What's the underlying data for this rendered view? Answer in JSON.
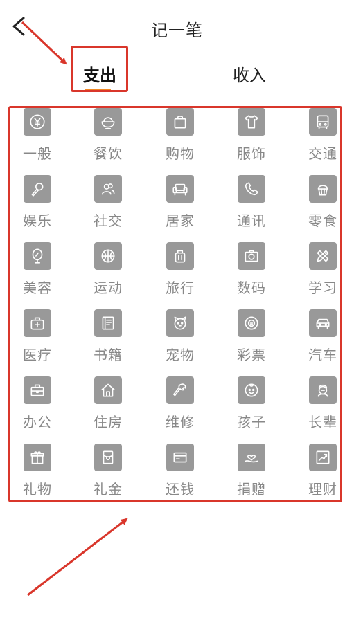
{
  "header": {
    "title": "记一笔",
    "back_icon": "chevron-left-icon"
  },
  "tabs": [
    {
      "label": "支出",
      "selected": true
    },
    {
      "label": "收入",
      "selected": false
    }
  ],
  "colors": {
    "accent": "#f08a24",
    "annotation": "#d9362b",
    "icon_bg": "#999999",
    "label": "#888888"
  },
  "categories": [
    {
      "label": "一般",
      "icon": "yen-coin-icon"
    },
    {
      "label": "餐饮",
      "icon": "rice-bowl-icon"
    },
    {
      "label": "购物",
      "icon": "shopping-bag-icon"
    },
    {
      "label": "服饰",
      "icon": "shirt-icon"
    },
    {
      "label": "交通",
      "icon": "bus-icon"
    },
    {
      "label": "娱乐",
      "icon": "microphone-icon"
    },
    {
      "label": "社交",
      "icon": "people-icon"
    },
    {
      "label": "居家",
      "icon": "sofa-icon"
    },
    {
      "label": "通讯",
      "icon": "phone-icon"
    },
    {
      "label": "零食",
      "icon": "cupcake-icon"
    },
    {
      "label": "美容",
      "icon": "mirror-icon"
    },
    {
      "label": "运动",
      "icon": "basketball-icon"
    },
    {
      "label": "旅行",
      "icon": "suitcase-icon"
    },
    {
      "label": "数码",
      "icon": "camera-icon"
    },
    {
      "label": "学习",
      "icon": "pencil-ruler-icon"
    },
    {
      "label": "医疗",
      "icon": "medical-kit-icon"
    },
    {
      "label": "书籍",
      "icon": "book-icon"
    },
    {
      "label": "宠物",
      "icon": "pet-face-icon"
    },
    {
      "label": "彩票",
      "icon": "lottery-ball-icon"
    },
    {
      "label": "汽车",
      "icon": "car-icon"
    },
    {
      "label": "办公",
      "icon": "briefcase-icon"
    },
    {
      "label": "住房",
      "icon": "house-icon"
    },
    {
      "label": "维修",
      "icon": "wrench-icon"
    },
    {
      "label": "孩子",
      "icon": "baby-face-icon"
    },
    {
      "label": "长辈",
      "icon": "elder-icon"
    },
    {
      "label": "礼物",
      "icon": "gift-icon"
    },
    {
      "label": "礼金",
      "icon": "red-envelope-icon"
    },
    {
      "label": "还钱",
      "icon": "credit-card-icon"
    },
    {
      "label": "捐赠",
      "icon": "heart-hand-icon"
    },
    {
      "label": "理财",
      "icon": "trend-chart-icon"
    }
  ]
}
